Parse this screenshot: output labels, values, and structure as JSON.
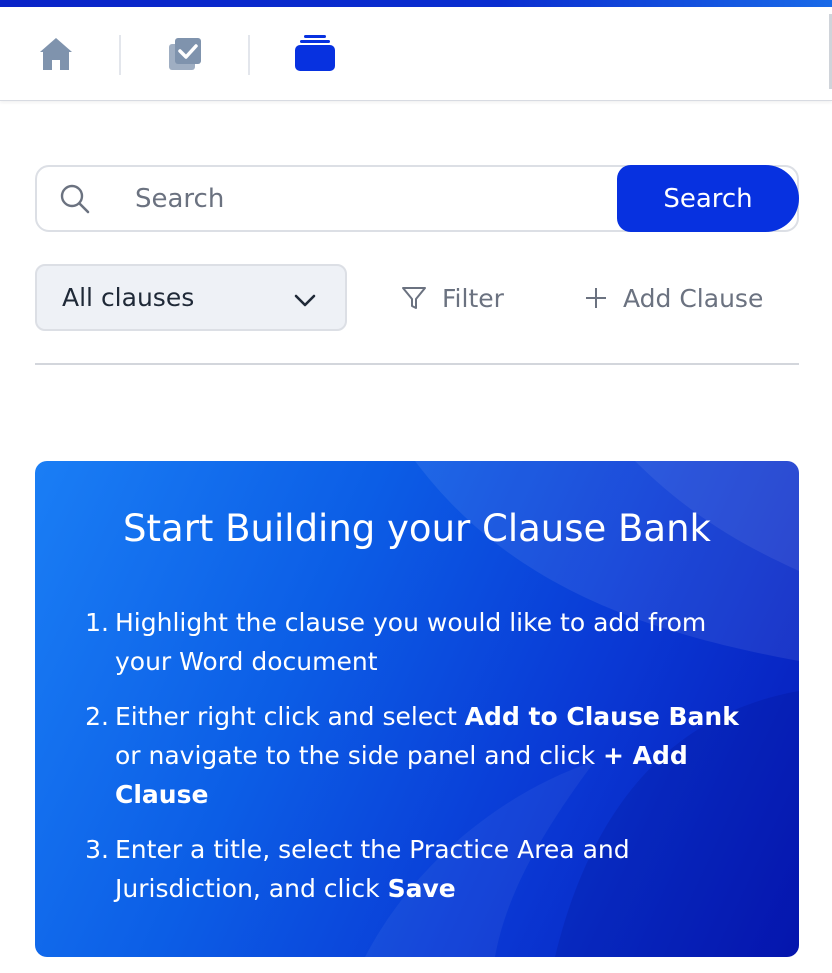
{
  "colors": {
    "accent": "#0731e0",
    "icon_inactive": "#7f93ad",
    "icon_active": "#0731e0",
    "promo_start": "#1a7ef5",
    "promo_end": "#0718b8"
  },
  "tabs": [
    {
      "icon": "home-icon",
      "active": false
    },
    {
      "icon": "checklist-icon",
      "active": false
    },
    {
      "icon": "clause-bank-icon",
      "active": true
    }
  ],
  "search": {
    "placeholder": "Search",
    "button_label": "Search"
  },
  "toolbar": {
    "filter_select_value": "All clauses",
    "filter_label": "Filter",
    "add_clause_label": "Add Clause"
  },
  "promo": {
    "title": "Start Building your Clause Bank",
    "step1_num": "1.",
    "step1_text": "Highlight the clause you would like to add from your Word document",
    "step2_num": "2.",
    "step2_a": "Either right click and select ",
    "step2_b": "Add to Clause Bank",
    "step2_c": " or navigate to the side panel and click ",
    "step2_d": "+ Add Clause",
    "step3_num": "3.",
    "step3_a": "Enter a title, select the Practice Area and Jurisdiction, and click ",
    "step3_b": "Save"
  }
}
